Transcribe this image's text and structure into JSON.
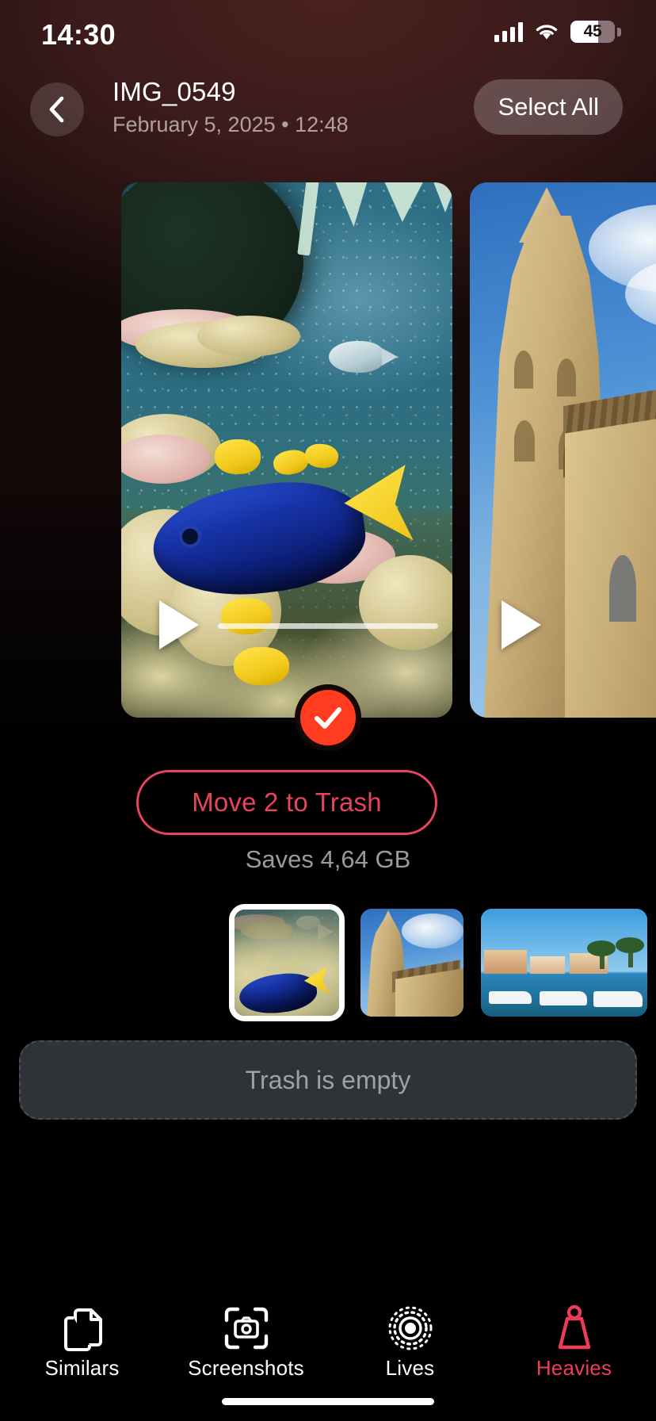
{
  "status_bar": {
    "time": "14:30",
    "battery_percent": "45",
    "icons": [
      "cellular-signal-icon",
      "wifi-icon",
      "battery-icon"
    ]
  },
  "header": {
    "back_icon": "chevron-left-icon",
    "title": "IMG_0549",
    "subtitle": "February 5, 2025 • 12:48",
    "select_all_label": "Select All"
  },
  "carousel": {
    "items": [
      {
        "name": "aquarium-video",
        "selected": true,
        "play_icon": "play-icon",
        "has_scrubber": true
      },
      {
        "name": "cathedral-video",
        "selected": false,
        "play_icon": "play-icon",
        "has_scrubber": false
      }
    ],
    "selection_badge_icon": "checkmark-icon"
  },
  "actions": {
    "trash_label": "Move 2 to Trash",
    "saves_label": "Saves 4,64 GB"
  },
  "thumbnails": [
    {
      "name": "thumb-aquarium",
      "selected": true
    },
    {
      "name": "thumb-cathedral",
      "selected": false
    },
    {
      "name": "thumb-marina",
      "selected": false
    }
  ],
  "trash_zone": {
    "label": "Trash is empty"
  },
  "tab_bar": {
    "items": [
      {
        "label": "Similars",
        "icon": "duplicate-documents-icon",
        "active": false
      },
      {
        "label": "Screenshots",
        "icon": "camera-frame-icon",
        "active": false
      },
      {
        "label": "Lives",
        "icon": "live-photo-icon",
        "active": false
      },
      {
        "label": "Heavies",
        "icon": "weight-icon",
        "active": true
      }
    ]
  },
  "colors": {
    "accent": "#ef3b5b",
    "destructive": "#e8445f",
    "selection": "#ff3b20",
    "background": "#000000",
    "header_tint": "#3b1b1b"
  }
}
